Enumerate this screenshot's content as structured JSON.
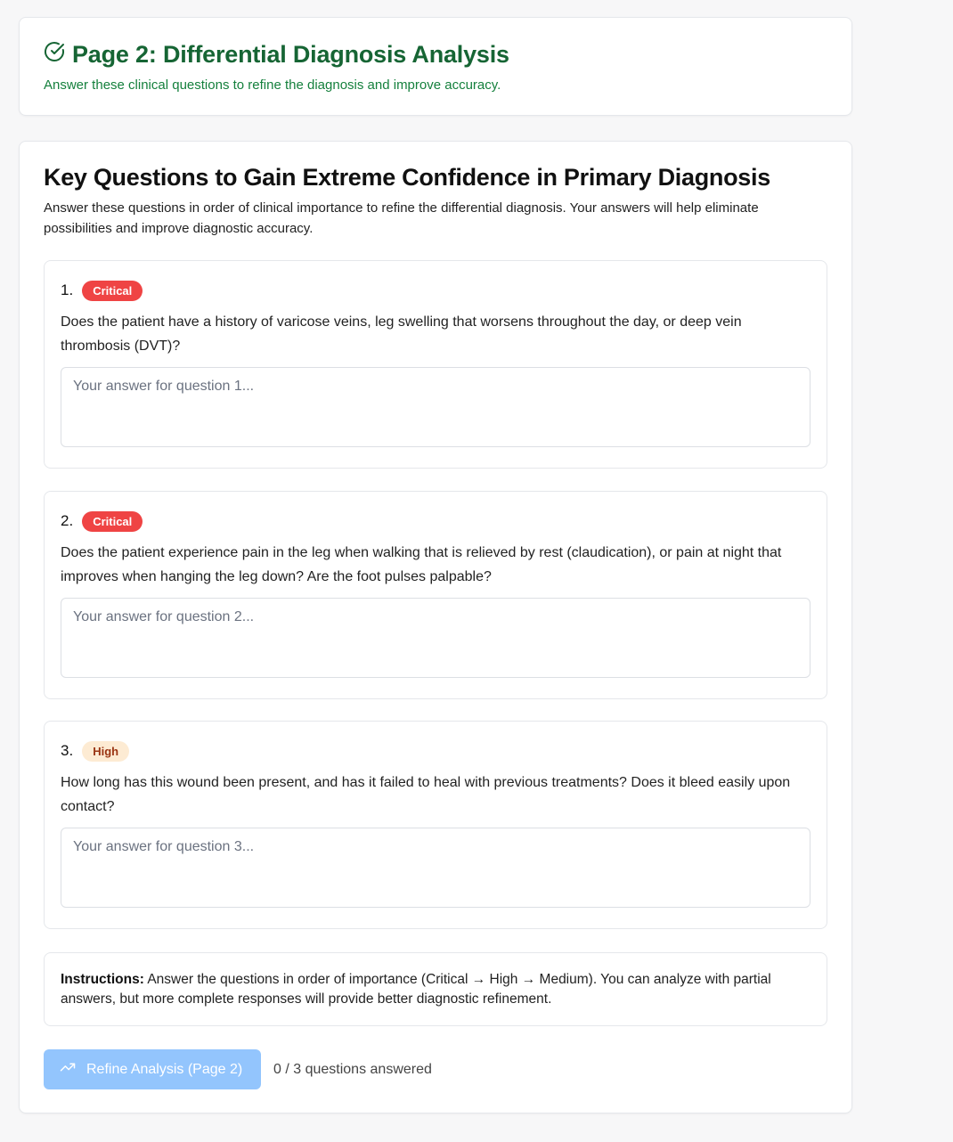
{
  "header": {
    "title": "Page 2: Differential Diagnosis Analysis",
    "subtitle": "Answer these clinical questions to refine the diagnosis and improve accuracy."
  },
  "main": {
    "title": "Key Questions to Gain Extreme Confidence in Primary Diagnosis",
    "description": "Answer these questions in order of clinical importance to refine the differential diagnosis. Your answers will help eliminate possibilities and improve diagnostic accuracy."
  },
  "questions": [
    {
      "number": "1.",
      "priority": "Critical",
      "text": "Does the patient have a history of varicose veins, leg swelling that worsens throughout the day, or deep vein thrombosis (DVT)?",
      "placeholder": "Your answer for question 1...",
      "value": ""
    },
    {
      "number": "2.",
      "priority": "Critical",
      "text": "Does the patient experience pain in the leg when walking that is relieved by rest (claudication), or pain at night that improves when hanging the leg down? Are the foot pulses palpable?",
      "placeholder": "Your answer for question 2...",
      "value": ""
    },
    {
      "number": "3.",
      "priority": "High",
      "text": "How long has this wound been present, and has it failed to heal with previous treatments? Does it bleed easily upon contact?",
      "placeholder": "Your answer for question 3...",
      "value": ""
    }
  ],
  "instructions": {
    "label": "Instructions:",
    "text": " Answer the questions in order of importance (Critical → High → Medium). You can analyze with partial answers, but more complete responses will provide better diagnostic refinement."
  },
  "actions": {
    "refine_label": "Refine Analysis (Page 2)",
    "progress": "0 / 3 questions answered"
  },
  "colors": {
    "header_green": "#166534",
    "critical": "#ef4444",
    "high_bg": "#fdebd3",
    "high_text": "#9a3412",
    "button_disabled": "#93c5fd"
  },
  "icons": {
    "header": "check-circle-icon",
    "refine": "trending-up-icon"
  }
}
